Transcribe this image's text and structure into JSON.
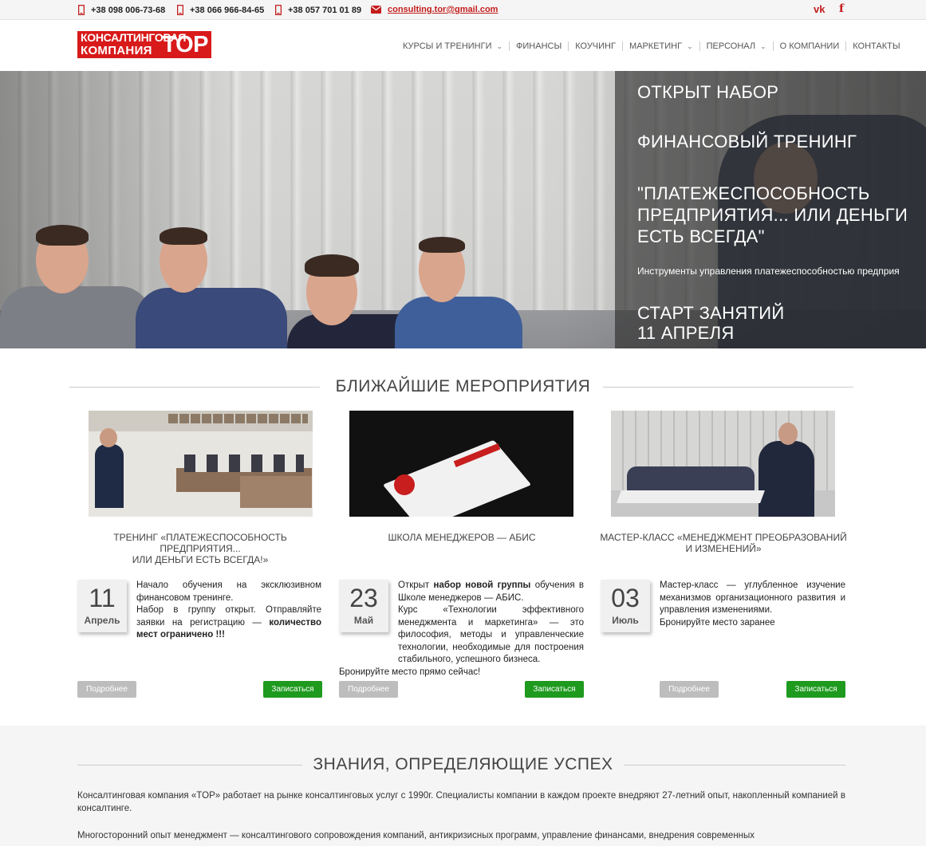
{
  "topbar": {
    "phones": [
      "+38 098 006-73-68",
      "+38 066 966-84-65",
      "+38 057 701 01 89"
    ],
    "email": "consulting.tor@gmail.com",
    "social": {
      "vk": "vk",
      "facebook": "f"
    }
  },
  "logo": {
    "line1": "КОНСАЛТИНГОВАЯ",
    "line2": "КОМПАНИЯ",
    "brand": "TOP"
  },
  "nav": {
    "items": [
      {
        "label": "КУРСЫ И ТРЕНИНГИ",
        "has_dropdown": true
      },
      {
        "label": "ФИНАНСЫ",
        "has_dropdown": false
      },
      {
        "label": "КОУЧИНГ",
        "has_dropdown": false
      },
      {
        "label": "МАРКЕТИНГ",
        "has_dropdown": true
      },
      {
        "label": "ПЕРСОНАЛ",
        "has_dropdown": true
      },
      {
        "label": "О КОМПАНИИ",
        "has_dropdown": false
      },
      {
        "label": "КОНТАКТЫ",
        "has_dropdown": false
      }
    ],
    "chevron": "⌄"
  },
  "hero": {
    "line1": "ОТКРЫТ НАБОР",
    "line2": "ФИНАНСОВЫЙ ТРЕНИНГ",
    "line3a": "\"ПЛАТЕЖЕСПОСОБНОСТЬ",
    "line3b": "ПРЕДПРИЯТИЯ... ИЛИ ДЕНЬГИ",
    "line3c": "ЕСТЬ ВСЕГДА\"",
    "subtitle": "Инструменты управления платежеспособностью предприя",
    "start1": "СТАРТ ЗАНЯТИЙ",
    "start2": "11 АПРЕЛЯ"
  },
  "events": {
    "section_title": "БЛИЖАЙШИЕ МЕРОПРИЯТИЯ",
    "items": [
      {
        "title1": "ТРЕНИНГ «ПЛАТЕЖЕСПОСОБНОСТЬ ПРЕДПРИЯТИЯ...",
        "title2": "ИЛИ ДЕНЬГИ ЕСТЬ ВСЕГДА!»",
        "day": "11",
        "month": "Апрель",
        "desc_p1": "Начало обучения на эксклюзивном финансовом тренинге.",
        "desc_p2_a": "Набор в группу открыт. Отправляйте заявки на регистрацию — ",
        "desc_p2_b": "количество мест ограничено !!!",
        "more": "Подробнее",
        "register": "Записаться"
      },
      {
        "title1": "ШКОЛА МЕНЕДЖЕРОВ — АБИС",
        "day": "23",
        "month": "Май",
        "desc_a": "Открыт ",
        "desc_b": "набор новой группы",
        "desc_c": " обучения в Школе менеджеров — АБИС.",
        "desc_d": "Курс «Технологии эффективного менеджмента и маркетинга» — это философия, методы и управленческие технологии, необходимые для построения стабильного, успешного бизнеса.",
        "desc_e": "Бронируйте место прямо сейчас!",
        "more": "Подробнее",
        "register": "Записаться"
      },
      {
        "title1": "МАСТЕР-КЛАСС «МЕНЕДЖМЕНТ ПРЕОБРАЗОВАНИЙ",
        "title2": "И ИЗМЕНЕНИЙ»",
        "day": "03",
        "month": "Июль",
        "desc_a": "Мастер-класс — углубленное изучение механизмов организационного развития и управления изменениями.",
        "desc_b": "Бронируйте место заранее",
        "more": "Подробнее",
        "register": "Записаться"
      }
    ]
  },
  "knowledge": {
    "title": "ЗНАНИЯ, ОПРЕДЕЛЯЮЩИЕ УСПЕХ",
    "p1": "Консалтинговая компания «TOP» работает на рынке консалтинговых услуг с 1990г. Специалисты компании в каждом проекте внедряют 27-летний опыт, накопленный компанией в консалтинге.",
    "p2": "Многосторонний опыт менеджмент — консалтингового сопровождения компаний, антикризисных программ, управление финансами, внедрения современных"
  },
  "colors": {
    "brand_red": "#d81a1a",
    "register_green": "#1e9a1e",
    "more_gray": "#bdbdbd"
  }
}
